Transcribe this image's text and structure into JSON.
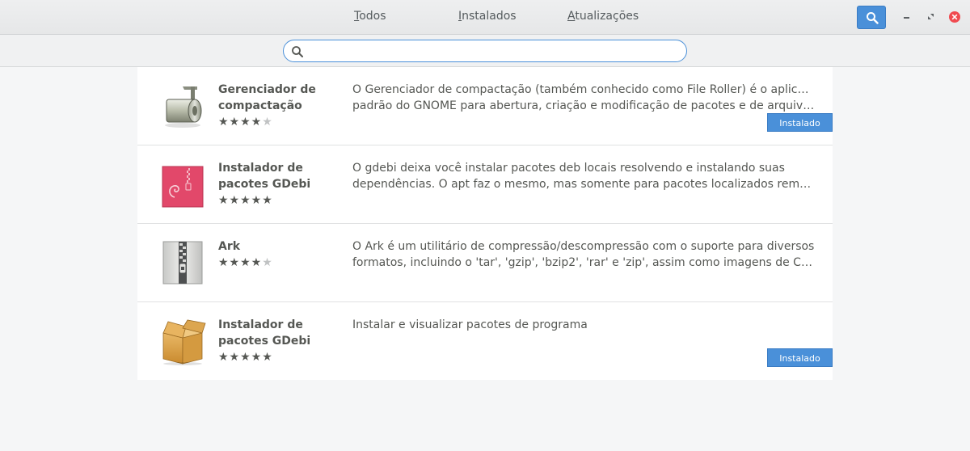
{
  "header": {
    "tabs": [
      {
        "label": "Todos",
        "mnemonic": "T",
        "rest": "odos"
      },
      {
        "label": "Instalados",
        "mnemonic": "I",
        "rest": "nstalados"
      },
      {
        "label": "Atualizações",
        "mnemonic": "A",
        "rest": "tualizações"
      }
    ],
    "search_button_icon": "search-icon",
    "window_controls": [
      "minimize-icon",
      "maximize-icon",
      "close-icon"
    ],
    "accent_color": "#4a90d9",
    "close_color": "#f04a50"
  },
  "search": {
    "value": "",
    "placeholder": ""
  },
  "apps": [
    {
      "name": "Gerenciador de compactação",
      "rating": 4,
      "max_rating": 5,
      "description_lines": [
        "O Gerenciador de compactação (também conhecido como File Roller) é o aplicativo",
        "padrão do GNOME para abertura, criação e modificação de pacotes e de arquivos de pac…"
      ],
      "status": "Instalado",
      "icon": "archive-roller-icon"
    },
    {
      "name": "Instalador de pacotes GDebi",
      "rating": 5,
      "max_rating": 5,
      "description_lines": [
        "O gdebi deixa você instalar pacotes deb locais resolvendo e instalando suas",
        "dependências. O apt faz o mesmo, mas somente para pacotes localizados remotament…"
      ],
      "status": "",
      "icon": "debian-package-icon"
    },
    {
      "name": "Ark",
      "rating": 4,
      "max_rating": 5,
      "description_lines": [
        "O Ark é um utilitário de compressão/descompressão com o suporte para diversos",
        "formatos, incluindo o 'tar', 'gzip', 'bzip2', 'rar' e 'zip', assim como imagens de CD-ROM. O …"
      ],
      "status": "",
      "icon": "zip-archive-icon"
    },
    {
      "name": "Instalador de pacotes GDebi",
      "rating": 5,
      "max_rating": 5,
      "description_lines": [
        "Instalar e visualizar pacotes de programa"
      ],
      "status": "Instalado",
      "icon": "cardboard-box-icon"
    }
  ]
}
